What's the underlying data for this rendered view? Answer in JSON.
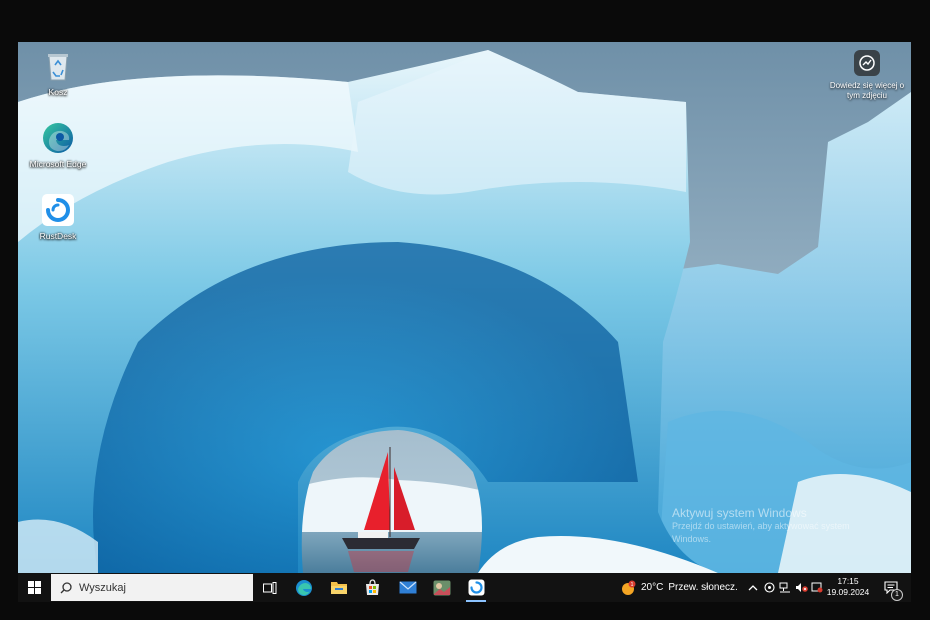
{
  "desktop": {
    "icons": [
      {
        "label": "Kosz",
        "icon": "recycle-bin-icon"
      },
      {
        "label": "Microsoft Edge",
        "icon": "edge-icon"
      },
      {
        "label": "RustDesk",
        "icon": "rustdesk-icon"
      }
    ],
    "learn_more": {
      "line1": "Dowiedz się więcej o",
      "line2": "tym zdjęciu"
    },
    "watermark": {
      "title": "Aktywuj system Windows",
      "line1": "Przejdź do ustawień, aby aktywować system",
      "line2": "Windows."
    }
  },
  "taskbar": {
    "search_placeholder": "Wyszukaj",
    "apps": [
      "task-view-icon",
      "edge-icon",
      "file-explorer-icon",
      "microsoft-store-icon",
      "mail-icon",
      "photos-icon",
      "rustdesk-icon"
    ],
    "weather": {
      "temp": "20°C",
      "condition": "Przew. słonecz.",
      "badge": "1"
    },
    "clock": {
      "time": "17:15",
      "date": "19.09.2024"
    },
    "notifications_count": "1"
  },
  "colors": {
    "taskbar": "#121212",
    "accent": "#0078d4",
    "sail": "#e8202c"
  }
}
